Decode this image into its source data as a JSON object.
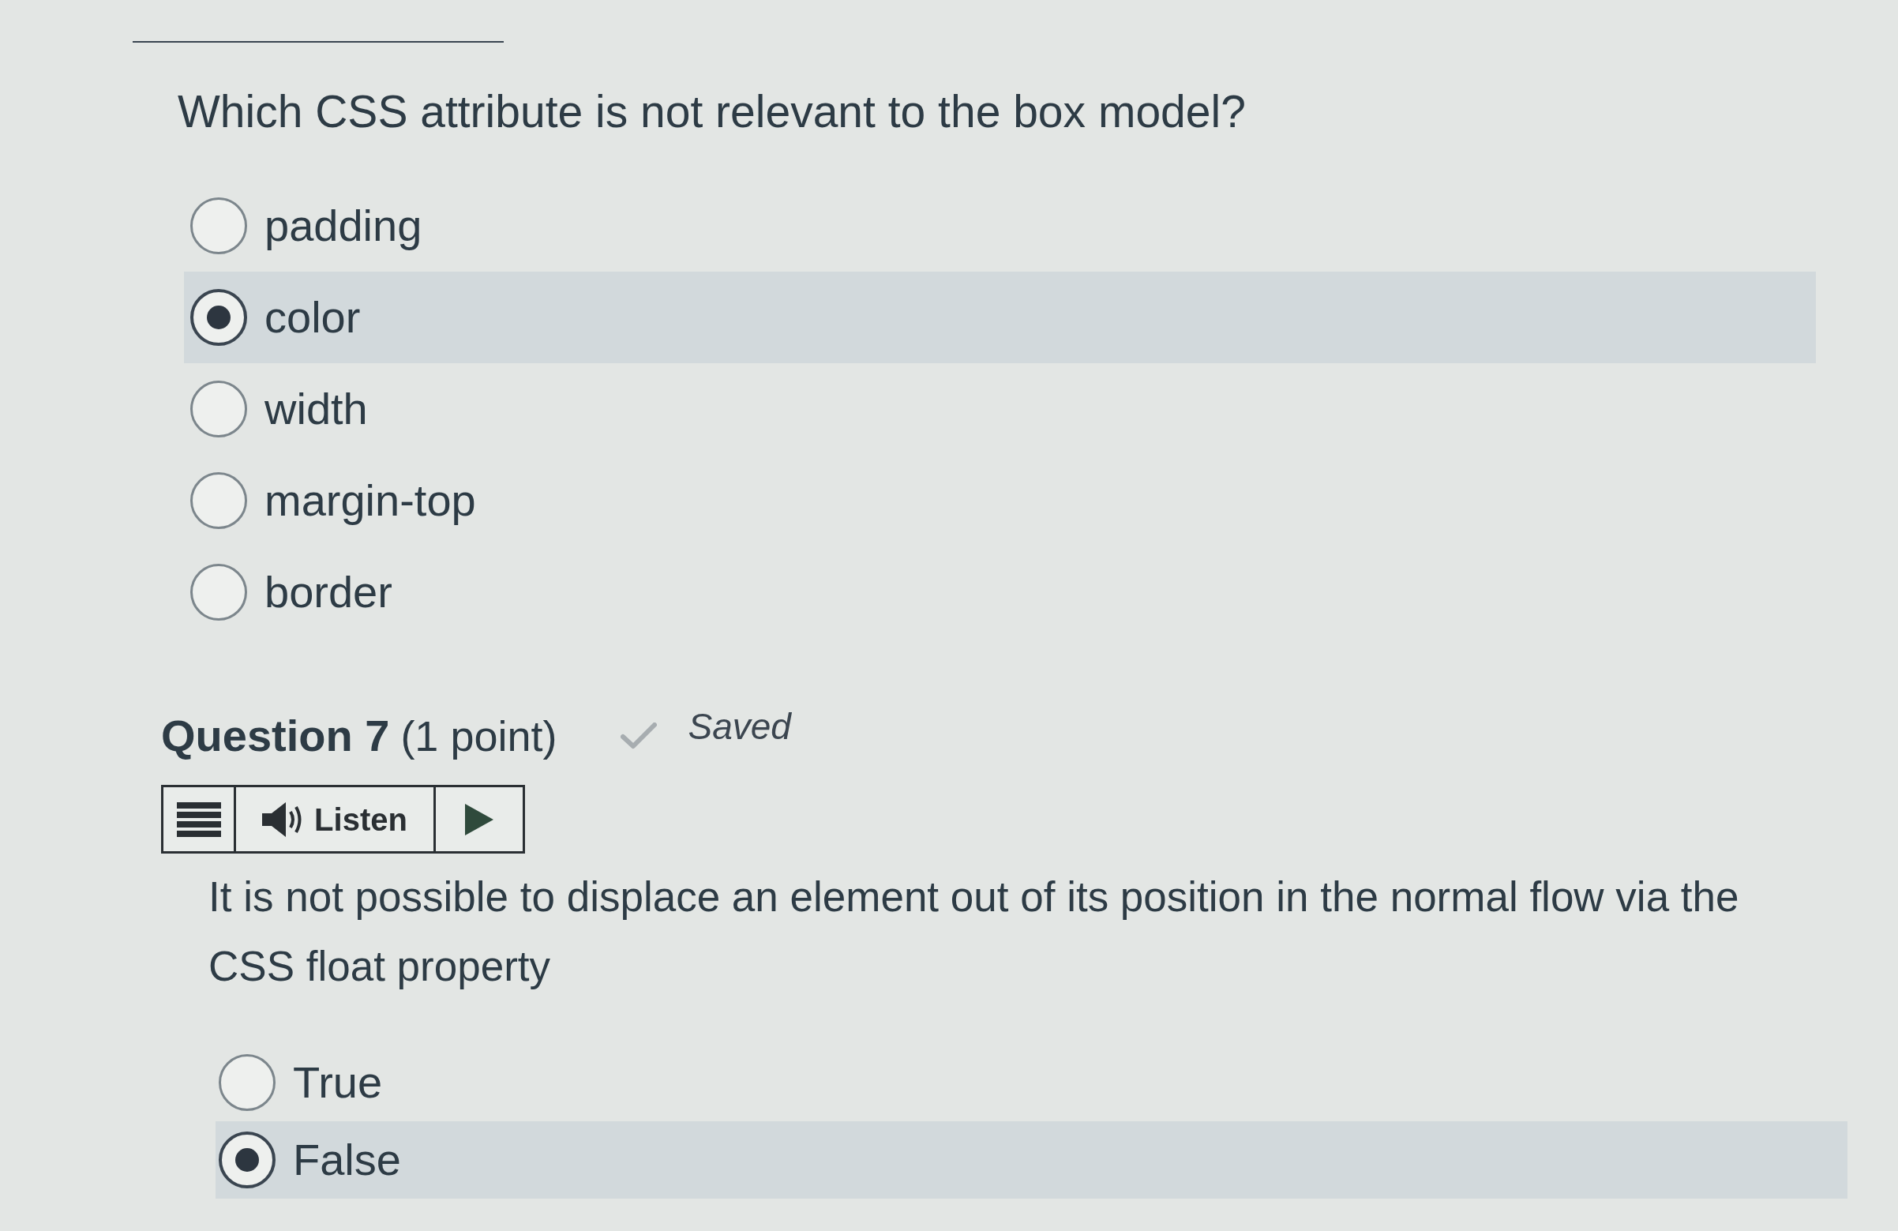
{
  "question_6": {
    "prompt": "Which CSS attribute is not relevant to the box model?",
    "options": [
      {
        "label": "padding",
        "selected": false
      },
      {
        "label": "color",
        "selected": true
      },
      {
        "label": "width",
        "selected": false
      },
      {
        "label": "margin-top",
        "selected": false
      },
      {
        "label": "border",
        "selected": false
      }
    ]
  },
  "question_7": {
    "title": "Question 7",
    "points": "(1 point)",
    "status": "Saved",
    "listen_toolbar": {
      "listen_button": "Listen"
    },
    "prompt": "It is not possible to displace an element out of its position in the normal flow via the CSS float property",
    "options": [
      {
        "label": "True",
        "selected": false
      },
      {
        "label": "False",
        "selected": true
      }
    ]
  }
}
